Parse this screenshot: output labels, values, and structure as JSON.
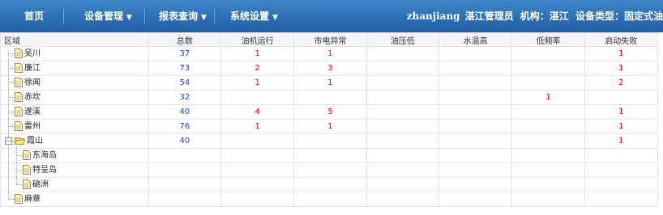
{
  "nav": {
    "home": "首页",
    "device_mgmt": "设备管理",
    "report_query": "报表查询",
    "system_settings": "系统设置"
  },
  "user": {
    "username": "zhanjiang",
    "role": "湛江管理员",
    "org_label": "机构：湛江",
    "device_type_label": "设备类型：固定式油"
  },
  "table": {
    "headers": [
      "区域",
      "总数",
      "油机运行",
      "市电异常",
      "油压低",
      "水温高",
      "低频率",
      "启动失败"
    ],
    "rows": [
      {
        "name": "吴川",
        "cells": [
          "37",
          "1",
          "1",
          "",
          "",
          "",
          "1"
        ]
      },
      {
        "name": "廉江",
        "cells": [
          "73",
          "2",
          "3",
          "",
          "",
          "",
          "1"
        ]
      },
      {
        "name": "徐闻",
        "cells": [
          "54",
          "1",
          "1",
          "",
          "",
          "",
          "2"
        ]
      },
      {
        "name": "赤坎",
        "cells": [
          "32",
          "",
          "",
          "",
          "",
          "1",
          ""
        ]
      },
      {
        "name": "遂溪",
        "cells": [
          "40",
          "4",
          "5",
          "",
          "",
          "",
          "1"
        ]
      },
      {
        "name": "雷州",
        "cells": [
          "76",
          "1",
          "1",
          "",
          "",
          "",
          "1"
        ]
      },
      {
        "name": "霞山",
        "cells": [
          "40",
          "",
          "",
          "",
          "",
          "",
          "1"
        ]
      },
      {
        "name": "东海岛",
        "cells": [
          "",
          "",
          "",
          "",
          "",
          "",
          ""
        ]
      },
      {
        "name": "特呈岛",
        "cells": [
          "",
          "",
          "",
          "",
          "",
          "",
          ""
        ]
      },
      {
        "name": "硇洲",
        "cells": [
          "",
          "",
          "",
          "",
          "",
          "",
          ""
        ]
      },
      {
        "name": "麻章",
        "cells": [
          "",
          "",
          "",
          "",
          "",
          "",
          ""
        ]
      }
    ]
  },
  "toggle_collapse": "−",
  "colors": {
    "nav_bg": "#2c6fb6",
    "count_blue": "#2245b8",
    "alert_red": "#e00000"
  }
}
